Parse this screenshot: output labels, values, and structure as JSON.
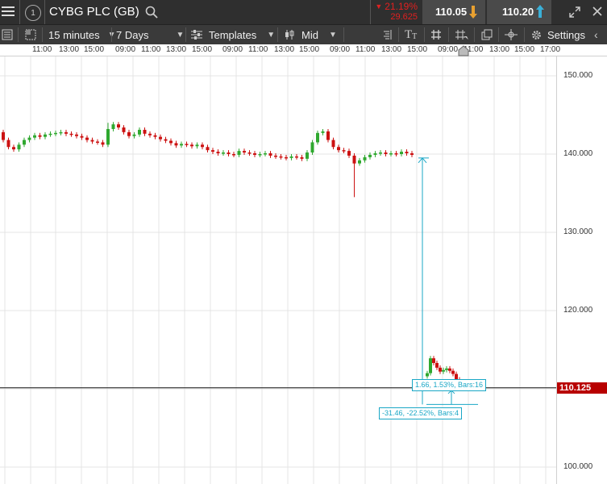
{
  "instrument": {
    "name": "CYBG PLC (GB)",
    "change_pct": "21.19%",
    "change_abs": "29.625",
    "sell": "110.05",
    "buy": "110.20"
  },
  "toolbar": {
    "interval": "15 minutes",
    "range": "7 Days",
    "templates": "Templates",
    "price_type": "Mid",
    "settings": "Settings"
  },
  "time_labels": [
    "11:00",
    "13:00",
    "15:00",
    "09:00",
    "11:00",
    "13:00",
    "15:00",
    "09:00",
    "11:00",
    "13:00",
    "15:00",
    "09:00",
    "11:00",
    "13:00",
    "15:00",
    "09:00",
    "11:00",
    "13:00",
    "15:00",
    "17:00"
  ],
  "price_labels": [
    "150.000",
    "140.000",
    "130.000",
    "120.000",
    "100.000"
  ],
  "current_price": "110.125",
  "measurements": {
    "upper": "1.66, 1.53%, Bars:16",
    "lower": "-31.46, -22.52%, Bars:4"
  },
  "colors": {
    "up": "#2fa82f",
    "down": "#cc1111",
    "measure": "#1aa7c6",
    "current_price_bg": "#b80000"
  },
  "chart_data": {
    "type": "candlestick",
    "y_ticks": [
      100,
      110,
      120,
      130,
      140,
      150
    ],
    "current_price": 110.125,
    "series_close": [
      141.8,
      140.9,
      140.6,
      141.2,
      141.8,
      142.1,
      142.4,
      142.2,
      142.5,
      142.6,
      142.7,
      142.8,
      142.6,
      142.5,
      142.3,
      142.1,
      141.8,
      141.6,
      141.5,
      141.2,
      143.2,
      143.8,
      143.4,
      142.8,
      142.3,
      142.5,
      143.1,
      142.6,
      142.4,
      142.2,
      141.9,
      141.7,
      141.4,
      141.1,
      141.3,
      141.2,
      141.0,
      141.2,
      140.9,
      140.5,
      140.3,
      140.1,
      140.2,
      140.0,
      139.9,
      140.4,
      140.2,
      140.1,
      139.9,
      140.0,
      140.1,
      139.8,
      139.7,
      139.6,
      139.5,
      139.7,
      139.6,
      139.4,
      140.2,
      141.5,
      142.7,
      142.9,
      141.8,
      140.9,
      140.5,
      140.4,
      139.8,
      138.8,
      139.2,
      139.6,
      139.9,
      140.1,
      140.2,
      140.0,
      140.1,
      140.0,
      140.3,
      140.1,
      139.9,
      112.0,
      113.9,
      113.3,
      112.7,
      112.2,
      112.4,
      112.6,
      112.3,
      111.9,
      111.2,
      110.9
    ]
  }
}
